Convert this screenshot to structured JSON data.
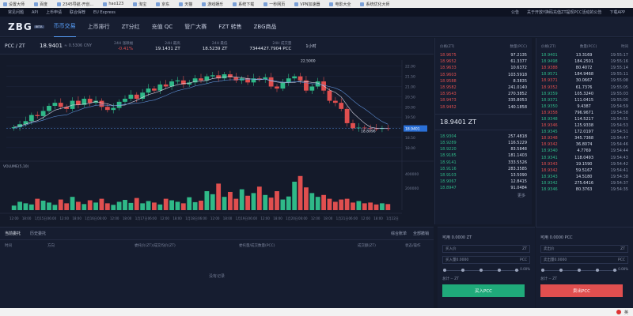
{
  "browser_bookmarks": [
    "设置大师",
    "百度",
    "2345导航-开创...",
    "hao123",
    "淘宝",
    "京东",
    "天猫",
    "游戏娱乐",
    "系统下载",
    "一秒网页",
    "VPN加速器",
    "电影大全",
    "系统优化大师"
  ],
  "top_nav": {
    "left": [
      "常见问题",
      "API",
      "上币申请",
      "联合保荐",
      "EU Express"
    ],
    "notice": "公告",
    "notice_text": "关于开放Y换码充值ZT提现PCC活动的公告",
    "download": "下载APP"
  },
  "brand": {
    "logo": "ZBG",
    "badge": "BETA"
  },
  "main_nav": [
    "币币交易",
    "上币排行",
    "ZT分红",
    "充值 QC",
    "管广大赛",
    "FZT 转售",
    "ZBG商品"
  ],
  "ticker": {
    "pair": "PCC / ZT",
    "price": "18.9401",
    "cny": "≈ 0.5306 CNY",
    "change_label": "24H 涨跌幅",
    "change_value": "-0.41%",
    "high_label": "24H 最高",
    "high_value": "19.1431 ZT",
    "low_label": "24H 最低",
    "low_value": "18.5239 ZT",
    "vol_label": "24H 成交量",
    "vol_value": "7344427.7904 PCC",
    "interval": "1小时"
  },
  "chart_data": {
    "type": "line",
    "title": "",
    "x_ticks": [
      "12:00",
      "18:00",
      "1月15日",
      "06:00",
      "12:00",
      "18:00",
      "1月16日",
      "06:00",
      "12:00",
      "18:00",
      "1月17日",
      "06:00",
      "12:00",
      "18:00",
      "1月18日",
      "06:00",
      "12:00",
      "18:00",
      "1月19日",
      "06:00",
      "12:00",
      "18:00",
      "1月20日",
      "06:00",
      "12:00",
      "18:00",
      "1月21日",
      "06:00",
      "12:00",
      "18:00",
      "1月22日"
    ],
    "price_axis": [
      "22.00",
      "21.50",
      "21.00",
      "20.50",
      "20.00",
      "19.50",
      "19.00",
      "18.50",
      "18.00"
    ],
    "ylim": [
      17.8,
      22.3
    ],
    "price_series": [
      19.0,
      19.15,
      19.3,
      19.6,
      19.55,
      19.8,
      20.05,
      20.2,
      20.0,
      19.9,
      20.3,
      20.1,
      20.4,
      20.2,
      20.3,
      20.0,
      19.85,
      19.95,
      20.25,
      20.4,
      20.6,
      20.4,
      20.7,
      20.9,
      20.8,
      21.1,
      21.0,
      21.25,
      21.3,
      21.1,
      21.2,
      21.4,
      21.3,
      21.5,
      21.55,
      21.4,
      21.6,
      21.45,
      21.3,
      21.4,
      21.2,
      21.4,
      21.35,
      21.45,
      21.0,
      20.9,
      21.2,
      21.4,
      21.5,
      21.3,
      20.8,
      21.0,
      21.25,
      20.8,
      20.3,
      20.2,
      19.9,
      19.2,
      18.95,
      18.98,
      18.96,
      18.94,
      18.93,
      18.95,
      18.94
    ],
    "max_label": "22.5000",
    "min_label": "18.8096",
    "last_price_label": "18.9401",
    "volume_title": "VOLUME(5,10)",
    "volume_axis": [
      "400000",
      "200000"
    ],
    "volume_series": [
      0.12,
      0.22,
      0.18,
      0.15,
      0.3,
      0.25,
      0.2,
      0.14,
      0.28,
      0.18,
      0.35,
      0.22,
      0.16,
      0.26,
      0.2,
      0.3,
      0.18,
      0.14,
      0.22,
      0.27,
      0.19,
      0.32,
      0.18,
      0.24,
      0.2,
      0.15,
      0.3,
      0.26,
      0.22,
      0.18,
      0.34,
      0.21,
      0.25,
      0.5,
      0.42,
      0.7,
      0.35,
      0.48,
      0.3,
      0.55,
      0.38,
      0.45,
      0.62,
      0.4,
      0.33,
      0.5,
      0.28,
      0.36,
      0.75,
      0.9,
      0.6,
      0.45,
      0.35,
      0.4,
      0.3,
      0.22,
      0.28,
      0.3,
      0.2,
      0.24,
      0.18,
      0.2,
      0.15,
      0.18,
      0.16
    ]
  },
  "orderbook": {
    "header_price": "价格(ZT)",
    "header_amount": "数量(PCC)",
    "asks": [
      [
        "18.9675",
        "97.2135"
      ],
      [
        "18.9652",
        "61.3377"
      ],
      [
        "18.9633",
        "10.6372"
      ],
      [
        "18.9603",
        "103.5918"
      ],
      [
        "18.9588",
        "8.3835"
      ],
      [
        "18.9582",
        "241.0140"
      ],
      [
        "18.9543",
        "270.3852"
      ],
      [
        "18.9473",
        "335.8053"
      ],
      [
        "18.9452",
        "140.1858"
      ]
    ],
    "last": "18.9401 ZT",
    "bids": [
      [
        "18.9304",
        "257.4818"
      ],
      [
        "18.9289",
        "116.5229"
      ],
      [
        "18.9220",
        "83.5848"
      ],
      [
        "18.9185",
        "181.1403"
      ],
      [
        "18.9141",
        "333.5526"
      ],
      [
        "18.9116",
        "283.3585"
      ],
      [
        "18.9103",
        "13.5090"
      ],
      [
        "18.9067",
        "12.8415"
      ],
      [
        "18.8947",
        "91.0484"
      ]
    ],
    "more": "更多"
  },
  "trades": {
    "header_price": "价格(ZT)",
    "header_amount": "数量(PCC)",
    "header_time": "时间",
    "rows": [
      [
        "18.9401",
        "13.3169",
        "19:55:17",
        "g"
      ],
      [
        "18.9498",
        "184.2501",
        "19:55:16",
        "g"
      ],
      [
        "18.9388",
        "80.4072",
        "19:55:14",
        "r"
      ],
      [
        "18.9571",
        "184.9468",
        "19:55:11",
        "g"
      ],
      [
        "18.9371",
        "30.0667",
        "19:55:08",
        "r"
      ],
      [
        "18.9352",
        "61.7376",
        "19:55:05",
        "r"
      ],
      [
        "18.9359",
        "105.3240",
        "19:55:03",
        "g"
      ],
      [
        "18.9371",
        "111.0415",
        "19:55:00",
        "g"
      ],
      [
        "18.9350",
        "9.4387",
        "19:54:59",
        "g"
      ],
      [
        "18.9358",
        "796.9671",
        "19:54:58",
        "r"
      ],
      [
        "18.9348",
        "114.5217",
        "19:54:55",
        "g"
      ],
      [
        "18.9346",
        "125.9338",
        "19:54:53",
        "r"
      ],
      [
        "18.9345",
        "172.0197",
        "19:54:51",
        "g"
      ],
      [
        "18.9348",
        "345.7368",
        "19:54:47",
        "r"
      ],
      [
        "18.9342",
        "36.8074",
        "19:54:46",
        "r"
      ],
      [
        "18.9340",
        "4.7769",
        "19:54:44",
        "g"
      ],
      [
        "18.9341",
        "118.0493",
        "19:54:43",
        "g"
      ],
      [
        "18.9343",
        "19.1590",
        "19:54:42",
        "r"
      ],
      [
        "18.9342",
        "59.5167",
        "19:54:41",
        "r"
      ],
      [
        "18.9343",
        "14.5180",
        "19:54:38",
        "g"
      ],
      [
        "18.9342",
        "275.6416",
        "19:54:37",
        "g"
      ],
      [
        "18.9346",
        "80.3763",
        "19:54:35",
        "g"
      ]
    ]
  },
  "orders": {
    "tabs": [
      "当前委托",
      "历史委托"
    ],
    "right_links": [
      "综合账单",
      "全部撤销"
    ],
    "columns": [
      "时间",
      "方向",
      "委托价(ZT)/成交均价(ZT)",
      "委托量/成交数量(PCC)",
      "成交额(ZT)",
      "状态/操作"
    ],
    "empty": "没有记录"
  },
  "buy_form": {
    "available": "可用  0.0000 ZT",
    "price_label": "买入价",
    "price_unit": "ZT",
    "amount_label": "买入量0.0000",
    "amount_unit": "PCC",
    "pct": "0.00%",
    "total": "总计  -- ZT",
    "button": "买入PCC"
  },
  "sell_form": {
    "available": "可用  0.0000 PCC",
    "price_label": "卖出价",
    "price_unit": "ZT",
    "amount_label": "卖出量0.0000",
    "amount_unit": "PCC",
    "pct": "0.00%",
    "total": "总计  -- ZT",
    "button": "卖出PCC"
  },
  "taskbar": {
    "label": "英"
  }
}
